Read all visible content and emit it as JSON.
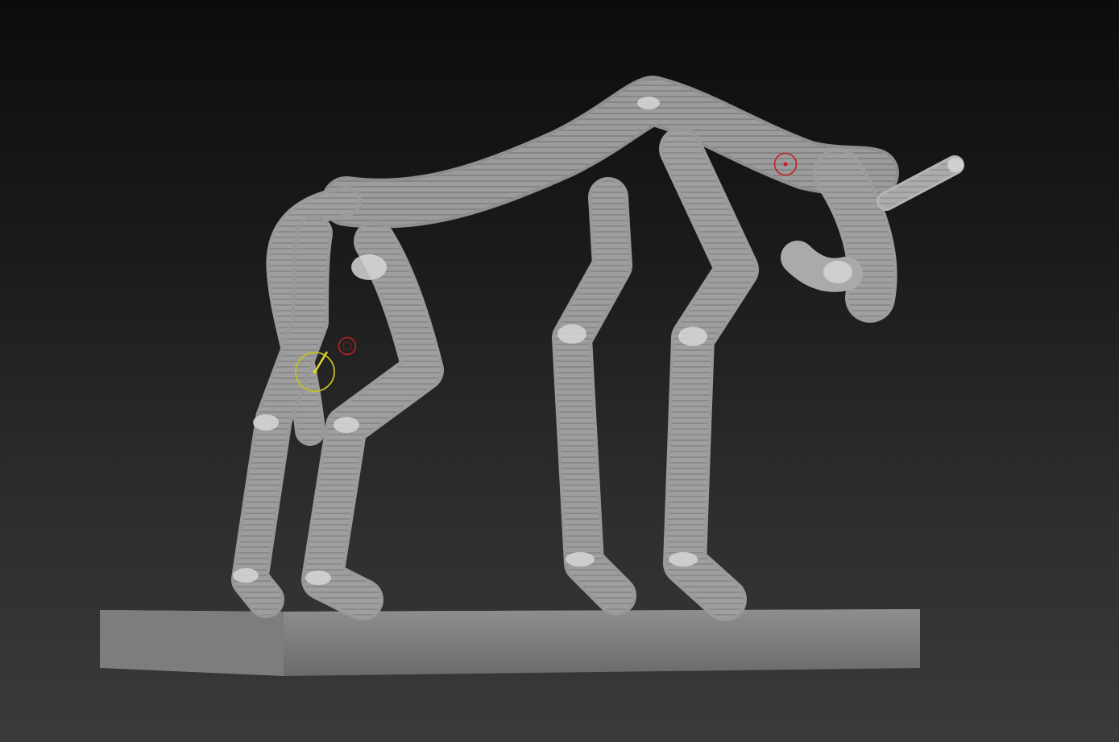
{
  "viewport": {
    "background_top": "#0c0c0c",
    "background_bottom": "#3a3a3a"
  },
  "model": {
    "base_color": "#9a9a9a",
    "base_top_color": "#7c7c7c",
    "segment_light": "#d8d8d8",
    "segment_mid": "#a8a8a8",
    "segment_dark": "#5a5a5a"
  },
  "gizmos": {
    "transpose_circle_color": "#c8c020",
    "marker_color": "#c02020"
  }
}
